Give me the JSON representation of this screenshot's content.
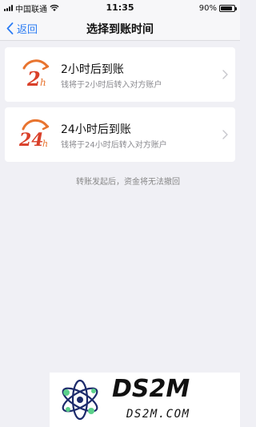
{
  "status_bar": {
    "carrier": "中国联通",
    "time": "11:35",
    "battery_percent": "90%",
    "battery_level": 0.9
  },
  "nav": {
    "back_label": "返回",
    "title": "选择到账时间"
  },
  "options": [
    {
      "title": "2小时后到账",
      "description": "钱将于2小时后转入对方账户",
      "logo_numeral": "2",
      "logo_suffix": "h",
      "icon": "clock-2h-icon"
    },
    {
      "title": "24小时后到账",
      "description": "钱将于24小时后转入对方账户",
      "logo_numeral": "24",
      "logo_suffix": "h",
      "icon": "clock-24h-icon"
    }
  ],
  "notice": "转账发起后，资金将无法撤回",
  "watermark": {
    "brand": "DS2M",
    "url": "DS2M.COM"
  },
  "colors": {
    "accent": "#2b7cf3",
    "logo_orange": "#e8742f",
    "logo_red": "#d9402a",
    "background": "#f0f0f5"
  }
}
